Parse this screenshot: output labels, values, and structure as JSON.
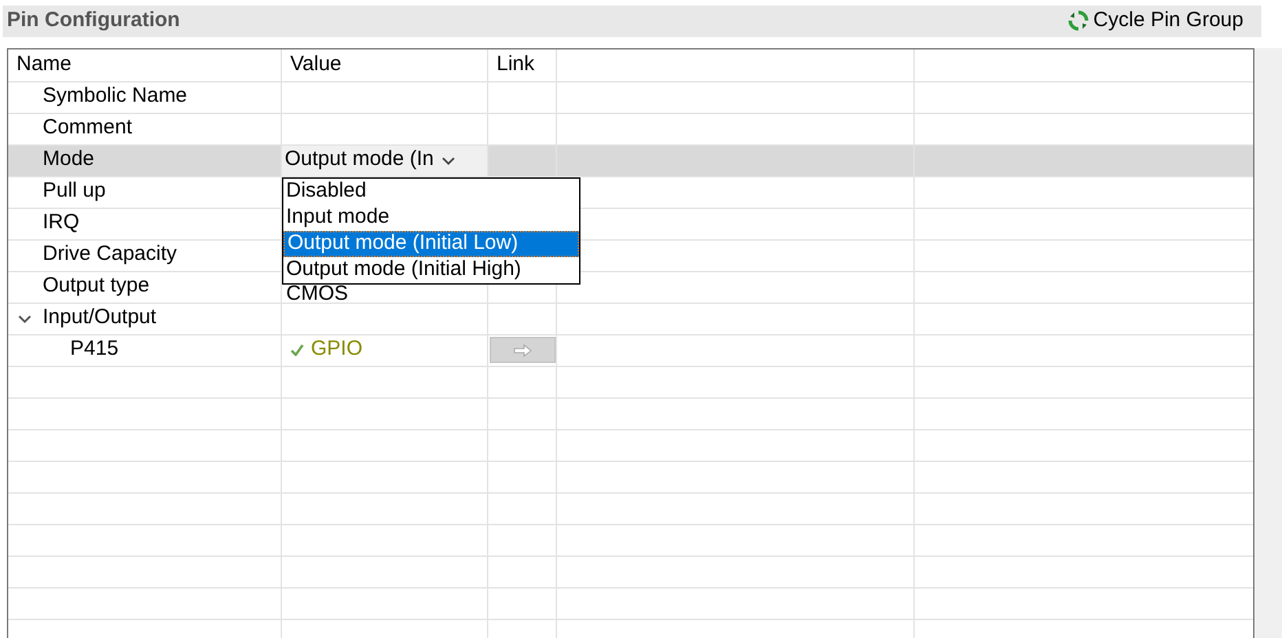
{
  "panel": {
    "title": "Pin Configuration",
    "action": "Cycle Pin Group"
  },
  "table": {
    "columns": [
      "Name",
      "Value",
      "Link"
    ],
    "rows": [
      {
        "name": "Symbolic Name",
        "value": "",
        "selected": false
      },
      {
        "name": "Comment",
        "value": "",
        "selected": false
      },
      {
        "name": "Mode",
        "value": "Output mode (In",
        "kind": "combo",
        "selected": true
      },
      {
        "name": "Pull up",
        "selected": false
      },
      {
        "name": "IRQ",
        "selected": false
      },
      {
        "name": "Drive Capacity",
        "selected": false
      },
      {
        "name": "Output type",
        "value": "CMOS",
        "selected": false
      },
      {
        "name": "Input/Output",
        "kind": "group",
        "expanded": true,
        "selected": false,
        "children": [
          {
            "name": "P415",
            "value": "GPIO",
            "kind": "pin",
            "selected": false
          }
        ]
      }
    ]
  },
  "dropdown": {
    "options": [
      {
        "label": "Disabled",
        "selected": false
      },
      {
        "label": "Input mode",
        "selected": false
      },
      {
        "label": "Output mode (Initial Low)",
        "selected": true
      },
      {
        "label": "Output mode (Initial High)",
        "selected": false
      }
    ]
  }
}
